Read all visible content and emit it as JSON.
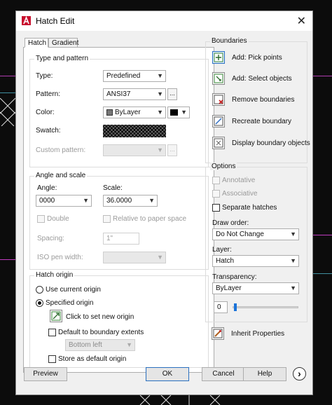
{
  "window": {
    "title": "Hatch Edit"
  },
  "tabs": [
    {
      "label": "Hatch"
    },
    {
      "label": "Gradient"
    }
  ],
  "type_pattern": {
    "title": "Type and pattern",
    "type_label": "Type:",
    "type_value": "Predefined",
    "pattern_label": "Pattern:",
    "pattern_value": "ANSI37",
    "browse_label": "...",
    "color_label": "Color:",
    "color_value": "ByLayer",
    "swatch_label": "Swatch:",
    "custom_pattern_label": "Custom pattern:",
    "custom_browse_label": "..."
  },
  "angle_scale": {
    "title": "Angle and scale",
    "angle_label": "Angle:",
    "angle_value": "0000",
    "scale_label": "Scale:",
    "scale_value": "36.0000",
    "double_label": "Double",
    "relative_label": "Relative to paper space",
    "spacing_label": "Spacing:",
    "spacing_value": "1\"",
    "iso_label": "ISO pen width:"
  },
  "hatch_origin": {
    "title": "Hatch origin",
    "use_current_label": "Use current origin",
    "specified_label": "Specified origin",
    "click_set_label": "Click to set new origin",
    "default_extents_label": "Default to boundary extents",
    "extents_value": "Bottom left",
    "store_default_label": "Store as default origin"
  },
  "boundaries": {
    "title": "Boundaries",
    "items": [
      {
        "label": "Add: Pick points"
      },
      {
        "label": "Add: Select objects"
      },
      {
        "label": "Remove boundaries"
      },
      {
        "label": "Recreate boundary"
      },
      {
        "label": "Display boundary objects"
      }
    ]
  },
  "options": {
    "title": "Options",
    "annotative_label": "Annotative",
    "associative_label": "Associative",
    "separate_label": "Separate hatches",
    "draw_order_label": "Draw order:",
    "draw_order_value": "Do Not Change",
    "layer_label": "Layer:",
    "layer_value": "Hatch",
    "transparency_label": "Transparency:",
    "transparency_value": "ByLayer",
    "transparency_number": "0",
    "transparency_level": 0
  },
  "inherit_label": "Inherit Properties",
  "footer": {
    "preview": "Preview",
    "ok": "OK",
    "cancel": "Cancel",
    "help": "Help",
    "more": "›"
  },
  "colors": {
    "accent": "#1a73d9",
    "background": "#0c0c0c",
    "cad_magenta": "#c040c0",
    "cad_cyan": "#40b0c0"
  }
}
